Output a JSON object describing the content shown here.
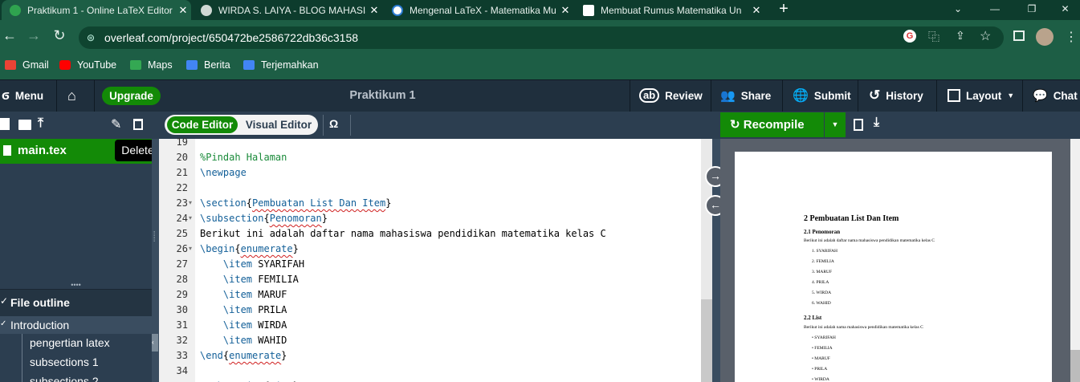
{
  "browser_tabs": [
    {
      "title": "Praktikum 1 - Online LaTeX Editor",
      "favicon": "overleaf-icon",
      "active": true
    },
    {
      "title": "WIRDA S. LAIYA - BLOG MAHASISWA",
      "favicon": "globe-icon",
      "active": false
    },
    {
      "title": "Mengenal LaTeX - Matematika Mu",
      "favicon": "compass-icon",
      "active": false
    },
    {
      "title": "Membuat Rumus Matematika Un",
      "favicon": "blank-page-icon",
      "active": false
    }
  ],
  "new_tab": "+",
  "url": "overleaf.com/project/650472be2586722db36c3158",
  "bookmarks": [
    "Gmail",
    "YouTube",
    "Maps",
    "Berita",
    "Terjemahkan"
  ],
  "toolbar": {
    "menu": "Menu",
    "upgrade": "Upgrade",
    "project_title": "Praktikum 1",
    "review": "Review",
    "share": "Share",
    "submit": "Submit",
    "history": "History",
    "layout": "Layout",
    "chat": "Chat"
  },
  "editor_toggle": {
    "code": "Code Editor",
    "visual": "Visual Editor"
  },
  "symbol_button": "Ω",
  "recompile": "Recompile",
  "file_tree": {
    "file": "main.tex",
    "tooltip": "Delete"
  },
  "outline": {
    "header": "File outline",
    "items": [
      "Introduction",
      "pengertian latex",
      "subsections 1",
      "subsections 2"
    ]
  },
  "code_lines": [
    {
      "n": "19",
      "text": ""
    },
    {
      "n": "20",
      "text": "%Pindah Halaman"
    },
    {
      "n": "21",
      "text": "\\newpage"
    },
    {
      "n": "22",
      "text": ""
    },
    {
      "n": "23",
      "text": "\\section{Pembuatan List Dan Item}"
    },
    {
      "n": "24",
      "text": "\\subsection{Penomoran}"
    },
    {
      "n": "25",
      "text": "Berikut ini adalah daftar nama mahasiswa pendidikan matematika kelas C"
    },
    {
      "n": "26",
      "text": "\\begin{enumerate}"
    },
    {
      "n": "27",
      "text": "    \\item SYARIFAH"
    },
    {
      "n": "28",
      "text": "    \\item FEMILIA"
    },
    {
      "n": "29",
      "text": "    \\item MARUF"
    },
    {
      "n": "30",
      "text": "    \\item PRILA"
    },
    {
      "n": "31",
      "text": "    \\item WIRDA"
    },
    {
      "n": "32",
      "text": "    \\item WAHID"
    },
    {
      "n": "33",
      "text": "\\end{enumerate}"
    },
    {
      "n": "34",
      "text": ""
    },
    {
      "n": "35",
      "text": "\\subsection{List}"
    }
  ],
  "pdf": {
    "section": "2   Pembuatan List Dan Item",
    "sub1": "2.1   Penomoran",
    "intro1": "Berikut ini adalah daftar nama mahasiswa pendidikan matematika kelas C",
    "enum": [
      "1.  SYARIFAH",
      "2.  FEMILIA",
      "3.  MARUF",
      "4.  PRILA",
      "5.  WIRDA",
      "6.  WAHID"
    ],
    "sub2": "2.2   List",
    "intro2": "Berikut ini adalah nama mahasiswa pendidikan matematika kelas C",
    "bullets": [
      "•  SYARIFAH",
      "•  FEMILIA",
      "•  MARUF",
      "•  PRILA",
      "•  WIRDA"
    ]
  },
  "colors": {
    "overleaf_green": "#138a07",
    "toolbar_dark": "#1f2f3d",
    "panel": "#2c3e50",
    "chrome_green": "#1d5e45"
  }
}
